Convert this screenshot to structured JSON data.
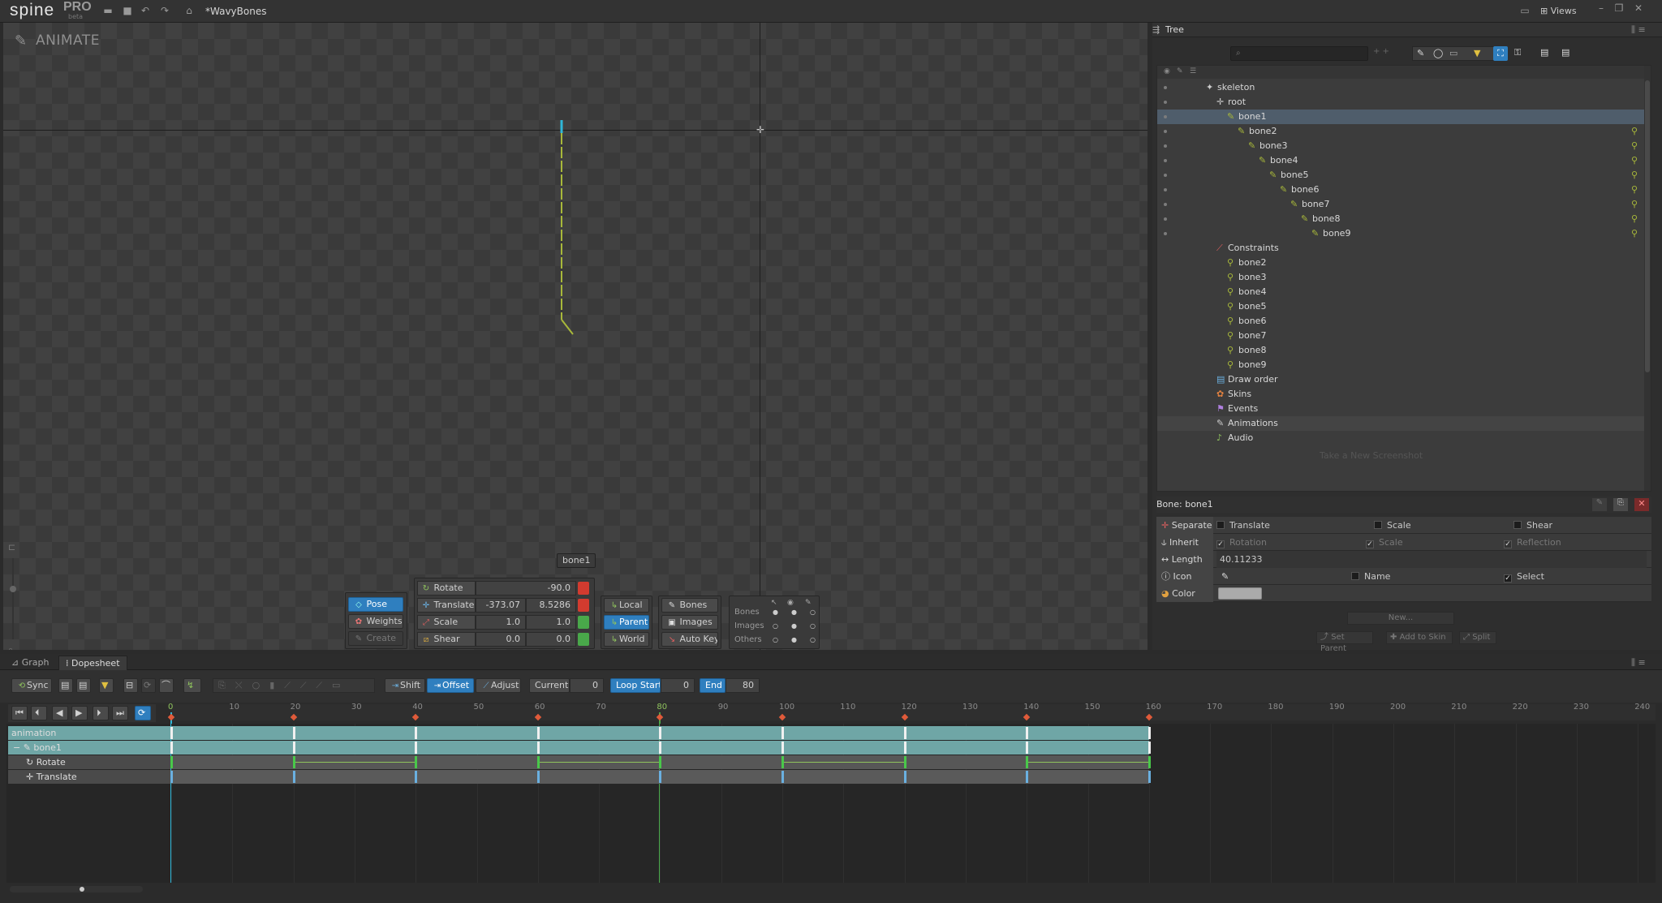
{
  "app": {
    "logo": "spine",
    "edition": "PRO",
    "edition_sub": "beta",
    "document_title": "*WavyBones",
    "views_label": "Views"
  },
  "viewport": {
    "mode_label": "ANIMATE",
    "bone_tooltip": "bone1"
  },
  "transform_tools": {
    "rotate": {
      "label": "Rotate",
      "value": "-90.0"
    },
    "translate": {
      "label": "Translate",
      "x": "-373.07",
      "y": "8.5286"
    },
    "scale": {
      "label": "Scale",
      "x": "1.0",
      "y": "1.0"
    },
    "shear": {
      "label": "Shear",
      "x": "0.0",
      "y": "0.0"
    }
  },
  "pose_tools": {
    "pose": "Pose",
    "weights": "Weights",
    "create": "Create"
  },
  "axes": {
    "local": "Local",
    "parent": "Parent",
    "world": "World"
  },
  "compensate": {
    "bones": "Bones",
    "images": "Images",
    "auto_key": "Auto Key"
  },
  "visibility": {
    "bones": "Bones",
    "images": "Images",
    "others": "Others"
  },
  "tree": {
    "title": "Tree",
    "screenshot_hint": "Take a New Screenshot",
    "rows": [
      {
        "label": "skeleton",
        "depth": 0,
        "icon": "skeleton-icon"
      },
      {
        "label": "root",
        "depth": 1,
        "icon": "root-icon"
      },
      {
        "label": "bone1",
        "depth": 2,
        "icon": "bone-icon",
        "selected": true
      },
      {
        "label": "bone2",
        "depth": 3,
        "icon": "bone-icon"
      },
      {
        "label": "bone3",
        "depth": 4,
        "icon": "bone-icon"
      },
      {
        "label": "bone4",
        "depth": 5,
        "icon": "bone-icon"
      },
      {
        "label": "bone5",
        "depth": 6,
        "icon": "bone-icon"
      },
      {
        "label": "bone6",
        "depth": 7,
        "icon": "bone-icon"
      },
      {
        "label": "bone7",
        "depth": 8,
        "icon": "bone-icon"
      },
      {
        "label": "bone8",
        "depth": 9,
        "icon": "bone-icon"
      },
      {
        "label": "bone9",
        "depth": 10,
        "icon": "bone-icon"
      },
      {
        "label": "Constraints",
        "depth": 1,
        "icon": "constraint-icon"
      },
      {
        "label": "bone2",
        "depth": 2,
        "icon": "ik-icon"
      },
      {
        "label": "bone3",
        "depth": 2,
        "icon": "ik-icon"
      },
      {
        "label": "bone4",
        "depth": 2,
        "icon": "ik-icon"
      },
      {
        "label": "bone5",
        "depth": 2,
        "icon": "ik-icon"
      },
      {
        "label": "bone6",
        "depth": 2,
        "icon": "ik-icon"
      },
      {
        "label": "bone7",
        "depth": 2,
        "icon": "ik-icon"
      },
      {
        "label": "bone8",
        "depth": 2,
        "icon": "ik-icon"
      },
      {
        "label": "bone9",
        "depth": 2,
        "icon": "ik-icon"
      },
      {
        "label": "Draw order",
        "depth": 1,
        "icon": "draw-order-icon"
      },
      {
        "label": "Skins",
        "depth": 1,
        "icon": "skins-icon"
      },
      {
        "label": "Events",
        "depth": 1,
        "icon": "events-icon"
      },
      {
        "label": "Animations",
        "depth": 1,
        "icon": "animations-icon",
        "highlight": true
      },
      {
        "label": "Audio",
        "depth": 1,
        "icon": "audio-icon"
      }
    ]
  },
  "properties": {
    "title": "Bone: bone1",
    "separate": {
      "label": "Separate",
      "translate": "Translate",
      "scale": "Scale",
      "shear": "Shear"
    },
    "inherit": {
      "label": "Inherit",
      "rotation": "Rotation",
      "scale": "Scale",
      "reflection": "Reflection"
    },
    "length": {
      "label": "Length",
      "value": "40.11233"
    },
    "icon": {
      "label": "Icon",
      "name": "Name",
      "select": "Select"
    },
    "color": {
      "label": "Color",
      "swatch": "#aaaaaa"
    },
    "new_button": "New...",
    "set_parent": "Set Parent",
    "add_to_skin": "Add to Skin",
    "split": "Split"
  },
  "timeline": {
    "tabs": [
      "Graph",
      "Dopesheet"
    ],
    "active_tab": "Dopesheet",
    "sync": "Sync",
    "shift": "Shift",
    "offset": "Offset",
    "adjust": "Adjust",
    "current_label": "Current",
    "current_value": "0",
    "loop_start_label": "Loop Start",
    "loop_start_value": "0",
    "end_label": "End",
    "end_value": "80",
    "ruler_ticks": [
      "0",
      "10",
      "20",
      "30",
      "40",
      "50",
      "60",
      "70",
      "80",
      "90",
      "100",
      "110",
      "120",
      "130",
      "140",
      "150",
      "160",
      "170",
      "180",
      "190",
      "200",
      "210",
      "220",
      "230",
      "240"
    ],
    "tracks": [
      {
        "label": "animation",
        "kind": "animation"
      },
      {
        "label": "bone1",
        "kind": "bone"
      },
      {
        "label": "Rotate",
        "kind": "rotate"
      },
      {
        "label": "Translate",
        "kind": "translate"
      }
    ],
    "keyframes": [
      0,
      20,
      40,
      60,
      80,
      100,
      120,
      140,
      160
    ]
  }
}
